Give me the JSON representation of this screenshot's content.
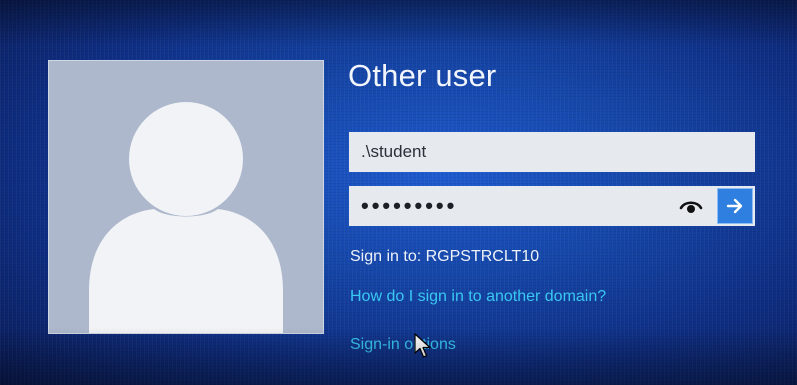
{
  "login": {
    "title": "Other user",
    "username": {
      "value": ".\\student"
    },
    "password": {
      "masked_value": "•••••••••",
      "reveal_icon": "eye-icon",
      "submit_icon": "arrow-right-icon"
    },
    "sign_in_to": "Sign in to: RGPSTRCLT10",
    "links": {
      "domain_help": "How do I sign in to another domain?",
      "sign_in_options": "Sign-in options"
    }
  },
  "colors": {
    "background_blue": "#1546a8",
    "link_cyan": "#39c8f2",
    "submit_blue": "#2f7fe0",
    "avatar_tile": "#aeb8cd"
  }
}
